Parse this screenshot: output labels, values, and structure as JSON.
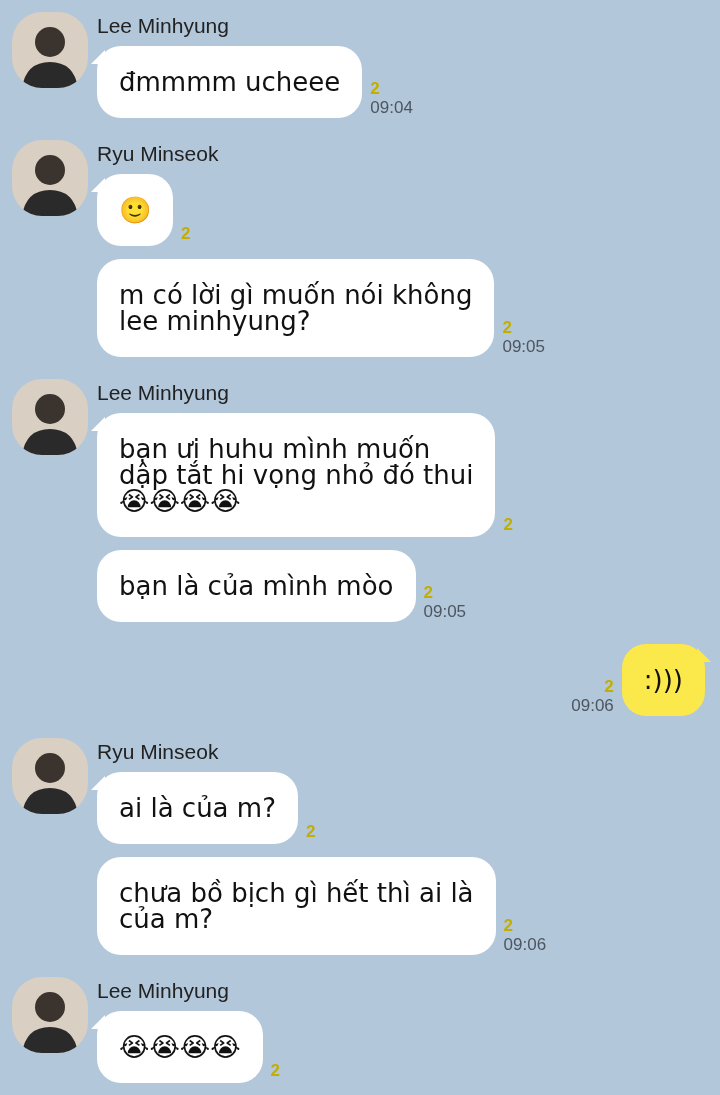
{
  "groups": [
    {
      "kind": "received",
      "sender": "Lee Minhyung",
      "messages": [
        {
          "text": "đmmmm ucheee",
          "unread": "2",
          "time": "09:04"
        }
      ]
    },
    {
      "kind": "received",
      "sender": "Ryu Minseok",
      "messages": [
        {
          "text": "🙂",
          "unread": "2"
        },
        {
          "text": "m có lời gì muốn nói không\nlee minhyung?",
          "unread": "2",
          "time": "09:05"
        }
      ]
    },
    {
      "kind": "received",
      "sender": "Lee Minhyung",
      "messages": [
        {
          "text": "bạn ưi huhu mình muốn\ndập tắt hi vọng nhỏ đó thui\n😭😭😭😭",
          "unread": "2"
        },
        {
          "text": "bạn là của mình mòo",
          "unread": "2",
          "time": "09:05"
        }
      ]
    },
    {
      "kind": "sent",
      "messages": [
        {
          "text": ":)))",
          "unread": "2",
          "time": "09:06"
        }
      ]
    },
    {
      "kind": "received",
      "sender": "Ryu Minseok",
      "messages": [
        {
          "text": "ai là của m?",
          "unread": "2"
        },
        {
          "text": "chưa bồ bịch gì hết thì ai là\ncủa m?",
          "unread": "2",
          "time": "09:06"
        }
      ]
    },
    {
      "kind": "received",
      "sender": "Lee Minhyung",
      "messages": [
        {
          "text": "😭😭😭😭",
          "unread": "2"
        }
      ]
    }
  ]
}
